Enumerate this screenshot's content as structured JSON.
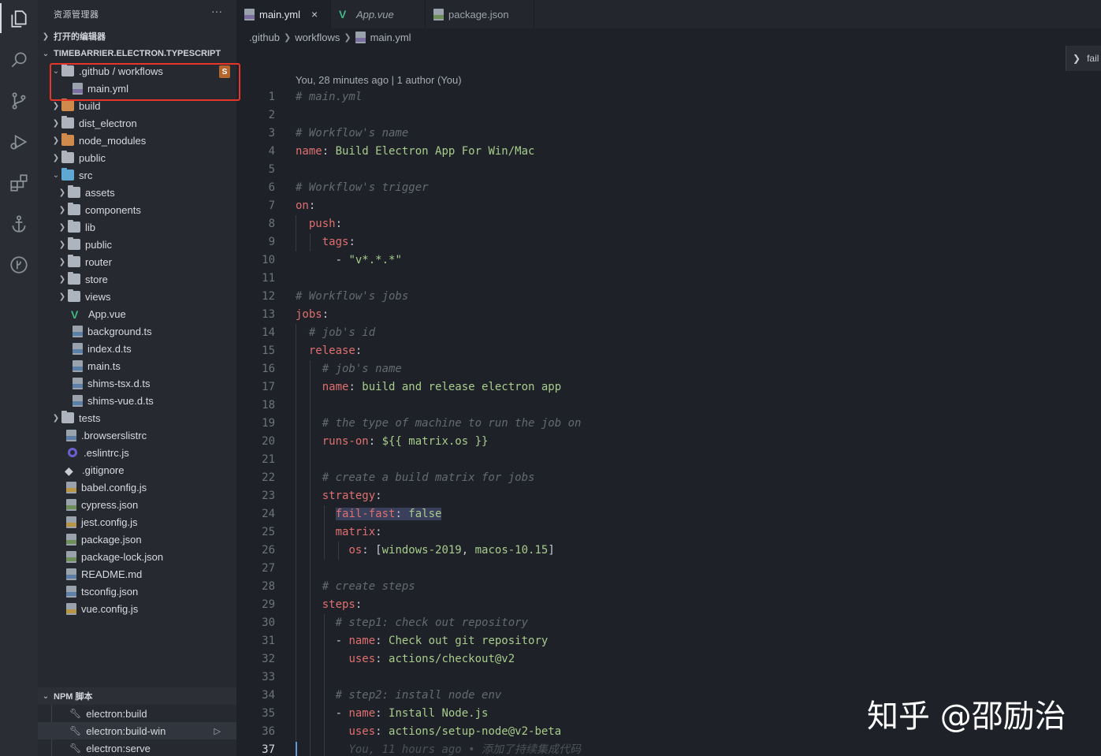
{
  "sidebar": {
    "title": "资源管理器",
    "more": "···",
    "open_editors": "打开的编辑器",
    "project": "TIMEBARRIER.ELECTRON.TYPESCRIPT",
    "badge": "S",
    "tree": [
      {
        "label": ".github / workflows"
      },
      {
        "label": "main.yml"
      },
      {
        "label": "build"
      },
      {
        "label": "dist_electron"
      },
      {
        "label": "node_modules"
      },
      {
        "label": "public"
      },
      {
        "label": "src"
      },
      {
        "label": "assets"
      },
      {
        "label": "components"
      },
      {
        "label": "lib"
      },
      {
        "label": "public"
      },
      {
        "label": "router"
      },
      {
        "label": "store"
      },
      {
        "label": "views"
      },
      {
        "label": "App.vue"
      },
      {
        "label": "background.ts"
      },
      {
        "label": "index.d.ts"
      },
      {
        "label": "main.ts"
      },
      {
        "label": "shims-tsx.d.ts"
      },
      {
        "label": "shims-vue.d.ts"
      },
      {
        "label": "tests"
      },
      {
        "label": ".browserslistrc"
      },
      {
        "label": ".eslintrc.js"
      },
      {
        "label": ".gitignore"
      },
      {
        "label": "babel.config.js"
      },
      {
        "label": "cypress.json"
      },
      {
        "label": "jest.config.js"
      },
      {
        "label": "package.json"
      },
      {
        "label": "package-lock.json"
      },
      {
        "label": "README.md"
      },
      {
        "label": "tsconfig.json"
      },
      {
        "label": "vue.config.js"
      }
    ],
    "npm_title": "NPM 脚本",
    "npm_scripts": [
      "electron:build",
      "electron:build-win",
      "electron:serve"
    ]
  },
  "tabs": [
    {
      "label": "main.yml",
      "close": "×"
    },
    {
      "label": "App.vue"
    },
    {
      "label": "package.json"
    }
  ],
  "breadcrumb": [
    ".github",
    "workflows",
    "main.yml"
  ],
  "peek_label": "fail",
  "editor": {
    "codelens": "You, 28 minutes ago | 1 author (You)",
    "line_numbers": [
      "1",
      "2",
      "3",
      "4",
      "5",
      "6",
      "7",
      "8",
      "9",
      "10",
      "11",
      "12",
      "13",
      "14",
      "15",
      "16",
      "17",
      "18",
      "19",
      "20",
      "21",
      "22",
      "23",
      "24",
      "25",
      "26",
      "27",
      "28",
      "29",
      "30",
      "31",
      "32",
      "33",
      "34",
      "35",
      "36",
      "37"
    ],
    "lines": {
      "l1": "# main.yml",
      "l3": "# Workflow's name",
      "l4k": "name",
      "l4v": "Build Electron App For Win/Mac",
      "l6": "# Workflow's trigger",
      "l7k": "on",
      "l8k": "push",
      "l9k": "tags",
      "l10v": "\"v*.*.*\"",
      "l12": "# Workflow's jobs",
      "l13k": "jobs",
      "l14": "# job's id",
      "l15k": "release",
      "l16": "# job's name",
      "l17k": "name",
      "l17v": "build and release electron app",
      "l19": "# the type of machine to run the job on",
      "l20k": "runs-on",
      "l20v": "${{ matrix.os }}",
      "l22": "# create a build matrix for jobs",
      "l23k": "strategy",
      "l24k": "fail-fast",
      "l24v": "false",
      "l25k": "matrix",
      "l26k": "os",
      "l26a": "windows-2019",
      "l26b": "macos-10.15",
      "l28": "# create steps",
      "l29k": "steps",
      "l30": "# step1: check out repository",
      "l31k": "name",
      "l31v": "Check out git repository",
      "l32k": "uses",
      "l32v": "actions/checkout@v2",
      "l34": "# step2: install node env",
      "l35k": "name",
      "l35v": "Install Node.js",
      "l36k": "uses",
      "l36v": "actions/setup-node@v2-beta",
      "l37blame": "You, 11 hours ago • 添加了持续集成代码"
    }
  },
  "watermark": "知乎 @邵励治"
}
